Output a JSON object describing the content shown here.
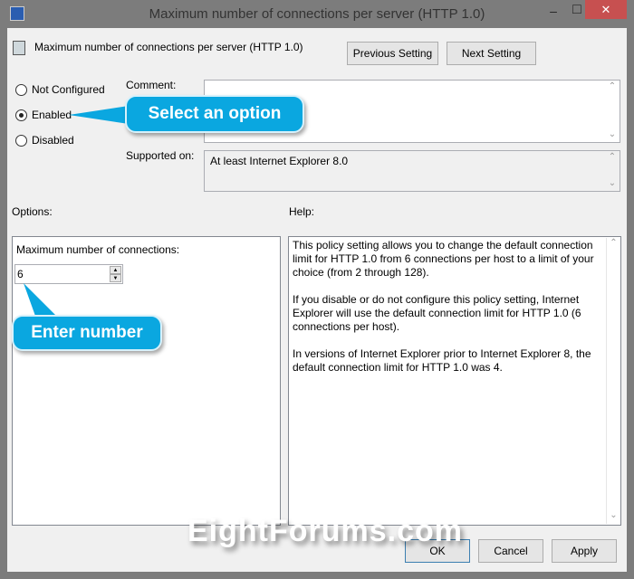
{
  "window": {
    "title": "Maximum number of connections per server (HTTP 1.0)",
    "minimize": "–",
    "maximize": "□",
    "close": "✕",
    "close_color": "#c75050"
  },
  "header": {
    "setting_name": "Maximum number of connections per server (HTTP 1.0)",
    "previous": "Previous Setting",
    "next": "Next Setting"
  },
  "state": {
    "options": [
      {
        "label": "Not Configured",
        "selected": false
      },
      {
        "label": "Enabled",
        "selected": true
      },
      {
        "label": "Disabled",
        "selected": false
      }
    ]
  },
  "comment": {
    "label": "Comment:",
    "value": ""
  },
  "supported": {
    "label": "Supported on:",
    "value": "At least Internet Explorer 8.0"
  },
  "options_label": "Options:",
  "help_label": "Help:",
  "options": {
    "field_label": "Maximum number of connections:",
    "value": "6"
  },
  "help": {
    "paragraphs": [
      "This policy setting allows you to change the default connection limit for HTTP 1.0 from 6 connections per host to a limit of your choice (from 2 through 128).",
      "If you disable or do not configure this policy setting, Internet Explorer will use the default connection limit for HTTP 1.0 (6 connections per host).",
      "In versions of Internet Explorer prior to Internet Explorer 8, the default connection limit for HTTP 1.0 was 4."
    ]
  },
  "footer": {
    "ok": "OK",
    "cancel": "Cancel",
    "apply": "Apply"
  },
  "annotations": {
    "select": "Select an option",
    "enter": "Enter number",
    "accent": "#0aa7e0"
  },
  "watermark": "EightForums.com"
}
